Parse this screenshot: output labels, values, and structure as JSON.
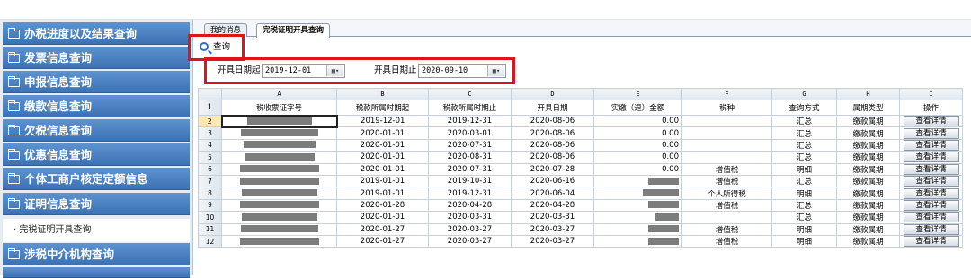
{
  "sidebar": {
    "items": [
      {
        "label": "办税进度以及结果查询"
      },
      {
        "label": "发票信息查询"
      },
      {
        "label": "申报信息查询"
      },
      {
        "label": "缴款信息查询"
      },
      {
        "label": "欠税信息查询"
      },
      {
        "label": "优惠信息查询"
      },
      {
        "label": "个体工商户核定定额信息"
      },
      {
        "label": "证明信息查询"
      },
      {
        "label": "涉税中介机构查询"
      }
    ],
    "submenu": {
      "label": "· 完税证明开具查询"
    }
  },
  "tabs": [
    {
      "label": "我的消息"
    },
    {
      "label": "完税证明开具查询"
    }
  ],
  "toolbar": {
    "query_label": "查询"
  },
  "filters": {
    "start_label": "开具日期起",
    "start_value": "2019-12-01",
    "end_label": "开具日期止",
    "end_value": "2020-09-10"
  },
  "grid": {
    "column_letters": [
      "A",
      "B",
      "C",
      "D",
      "E",
      "F",
      "G",
      "H",
      "I"
    ],
    "header_row_num": "1",
    "headers": [
      "税收票证字号",
      "税款所属时期起",
      "税款所属时期止",
      "开具日期",
      "实缴（退）金额",
      "税种",
      "查询方式",
      "属期类型",
      "操作"
    ],
    "detail_label": "查看详情",
    "rows": [
      {
        "num": "2",
        "start": "2019-12-01",
        "end": "2019-12-31",
        "date": "2020-08-06",
        "amount": "0.00",
        "tax": "",
        "method": "汇总",
        "type": "缴款属期"
      },
      {
        "num": "3",
        "start": "2020-01-01",
        "end": "2020-03-01",
        "date": "2020-08-06",
        "amount": "0.00",
        "tax": "",
        "method": "汇总",
        "type": "缴款属期"
      },
      {
        "num": "4",
        "start": "2020-01-01",
        "end": "2020-07-31",
        "date": "2020-08-06",
        "amount": "0.00",
        "tax": "",
        "method": "汇总",
        "type": "缴款属期"
      },
      {
        "num": "5",
        "start": "2020-01-01",
        "end": "2020-08-31",
        "date": "2020-08-06",
        "amount": "0.00",
        "tax": "",
        "method": "汇总",
        "type": "缴款属期"
      },
      {
        "num": "6",
        "start": "2020-01-01",
        "end": "2020-07-31",
        "date": "2020-07-28",
        "amount": "0.00",
        "tax": "增值税",
        "method": "明细",
        "type": "缴款属期"
      },
      {
        "num": "7",
        "start": "2019-01-01",
        "end": "2019-10-31",
        "date": "2020-06-16",
        "amount": "",
        "tax": "增值税",
        "method": "汇总",
        "type": "缴款属期"
      },
      {
        "num": "8",
        "start": "2019-01-01",
        "end": "2019-12-31",
        "date": "2020-06-04",
        "amount": "",
        "tax": "个人所得税",
        "method": "明细",
        "type": "缴款属期"
      },
      {
        "num": "9",
        "start": "2020-01-28",
        "end": "2020-04-28",
        "date": "2020-04-28",
        "amount": "",
        "tax": "增值税",
        "method": "汇总",
        "type": "缴款属期"
      },
      {
        "num": "10",
        "start": "2020-01-01",
        "end": "2020-03-31",
        "date": "2020-03-31",
        "amount": "",
        "tax": "",
        "method": "汇总",
        "type": "缴款属期"
      },
      {
        "num": "11",
        "start": "2020-01-27",
        "end": "2020-03-27",
        "date": "2020-03-27",
        "amount": "",
        "tax": "增值税",
        "method": "明细",
        "type": "缴款属期"
      },
      {
        "num": "12",
        "start": "2020-01-27",
        "end": "2020-03-27",
        "date": "2020-03-27",
        "amount": "",
        "tax": "增值税",
        "method": "明细",
        "type": "缴款属期"
      }
    ]
  }
}
